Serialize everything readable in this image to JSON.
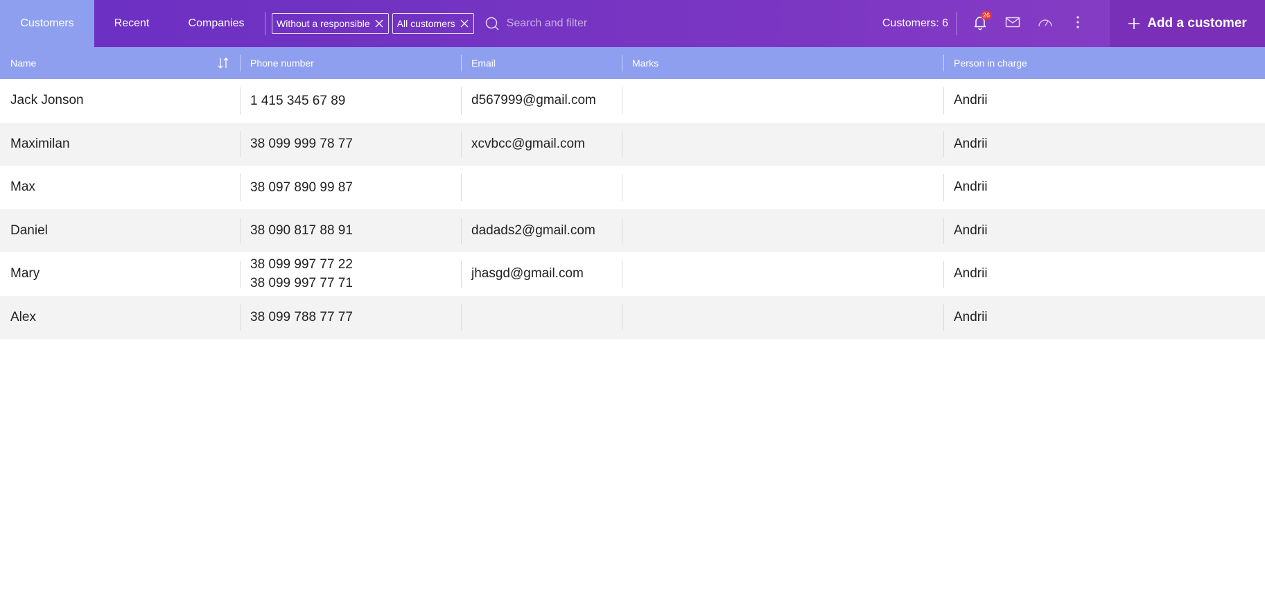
{
  "tabs": [
    {
      "label": "Customers",
      "active": true
    },
    {
      "label": "Recent",
      "active": false
    },
    {
      "label": "Companies",
      "active": false
    }
  ],
  "filters": [
    {
      "label": "Without a responsible"
    },
    {
      "label": "All customers"
    }
  ],
  "search": {
    "placeholder": "Search and filter",
    "value": ""
  },
  "counter": "Customers: 6",
  "notifications": {
    "badge": "26"
  },
  "add_button": {
    "label": "Add a customer"
  },
  "icons": {
    "search": "search-icon",
    "bell": "bell-icon",
    "mail": "mail-icon",
    "gauge": "gauge-icon",
    "more": "more-vertical-icon",
    "plus": "plus-icon",
    "sort": "sort-icon",
    "close": "close-icon"
  },
  "colors": {
    "topbar": "#7333c2",
    "active_tab": "#8f9ff0",
    "header": "#8f9ff0",
    "add_button": "#7a2fb8",
    "badge": "#e53935",
    "row_alt": "#f3f3f3"
  },
  "table": {
    "columns": [
      "Name",
      "Phone number",
      "Email",
      "Marks",
      "Person in charge"
    ],
    "rows": [
      {
        "name": "Jack Jonson",
        "phones": [
          "1 415 345 67 89"
        ],
        "email": "d567999@gmail.com",
        "marks": "",
        "person": "Andrii"
      },
      {
        "name": "Maximilan",
        "phones": [
          "38 099 999 78 77"
        ],
        "email": "xcvbcc@gmail.com",
        "marks": "",
        "person": "Andrii"
      },
      {
        "name": "Max",
        "phones": [
          "38 097 890 99 87"
        ],
        "email": "",
        "marks": "",
        "person": "Andrii"
      },
      {
        "name": "Daniel",
        "phones": [
          "38 090 817 88 91"
        ],
        "email": "dadads2@gmail.com",
        "marks": "",
        "person": "Andrii"
      },
      {
        "name": "Mary",
        "phones": [
          "38 099 997 77 22",
          "38 099 997 77 71"
        ],
        "email": "jhasgd@gmail.com",
        "marks": "",
        "person": "Andrii"
      },
      {
        "name": "Alex",
        "phones": [
          "38 099 788 77 77"
        ],
        "email": "",
        "marks": "",
        "person": "Andrii"
      }
    ]
  }
}
